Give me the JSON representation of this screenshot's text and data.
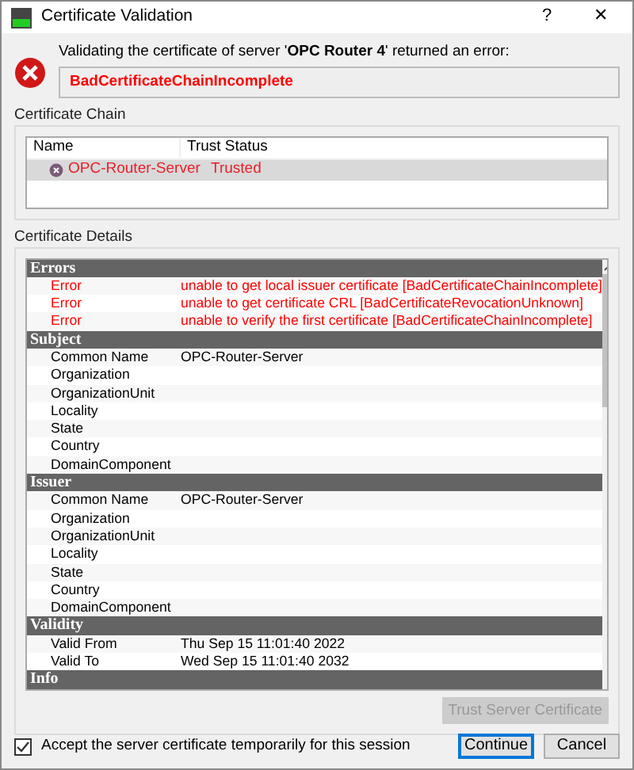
{
  "window": {
    "title": "Certificate Validation",
    "help": "?",
    "close": "✕"
  },
  "message": "Validating the certificate of server '**OPC Router 4**' returned an error:",
  "error_code": "BadCertificateChainIncomplete",
  "chain": {
    "title": "Certificate Chain",
    "columns": [
      "Name",
      "Trust Status"
    ],
    "rows": [
      {
        "name": "OPC-Router-Server",
        "trust_status": "Trusted",
        "selected": true
      }
    ]
  },
  "details": {
    "title": "Certificate Details",
    "groups": [
      {
        "title": "Errors",
        "rows": [
          {
            "kind": "error",
            "label": "Error",
            "value": "unable to get local issuer certificate [BadCertificateChainIncomplete]"
          },
          {
            "kind": "error",
            "label": "Error",
            "value": "unable to get certificate CRL [BadCertificateRevocationUnknown]"
          },
          {
            "kind": "error",
            "label": "Error",
            "value": "unable to verify the first certificate [BadCertificateChainIncomplete]"
          }
        ]
      },
      {
        "title": "Subject",
        "rows": [
          {
            "kind": "field",
            "label": "Common Name",
            "value": "OPC-Router-Server"
          },
          {
            "kind": "field",
            "label": "Organization"
          },
          {
            "kind": "field",
            "label": "OrganizationUnit"
          },
          {
            "kind": "field",
            "label": "Locality"
          },
          {
            "kind": "field",
            "label": "State"
          },
          {
            "kind": "field",
            "label": "Country"
          },
          {
            "kind": "field",
            "label": "DomainComponent"
          }
        ]
      },
      {
        "title": "Issuer",
        "rows": [
          {
            "kind": "field",
            "label": "Common Name",
            "value": "OPC-Router-Server"
          },
          {
            "kind": "field",
            "label": "Organization"
          },
          {
            "kind": "field",
            "label": "OrganizationUnit"
          },
          {
            "kind": "field",
            "label": "Locality"
          },
          {
            "kind": "field",
            "label": "State"
          },
          {
            "kind": "field",
            "label": "Country"
          },
          {
            "kind": "field",
            "label": "DomainComponent"
          }
        ]
      },
      {
        "title": "Validity",
        "rows": [
          {
            "kind": "field",
            "label": "Valid From",
            "value": "Thu Sep 15 11:01:40 2022"
          },
          {
            "kind": "field",
            "label": "Valid To",
            "value": "Wed Sep 15 11:01:40 2032"
          }
        ]
      },
      {
        "title": "Info"
      }
    ]
  },
  "trust_button": {
    "label": "Trust Server Certificate",
    "disabled": true
  },
  "accept": {
    "label": "Accept the server certificate temporarily for this session",
    "checked": true
  },
  "buttons": [
    {
      "label": "Continue",
      "default": true
    },
    {
      "label": "Cancel",
      "default": false
    }
  ]
}
